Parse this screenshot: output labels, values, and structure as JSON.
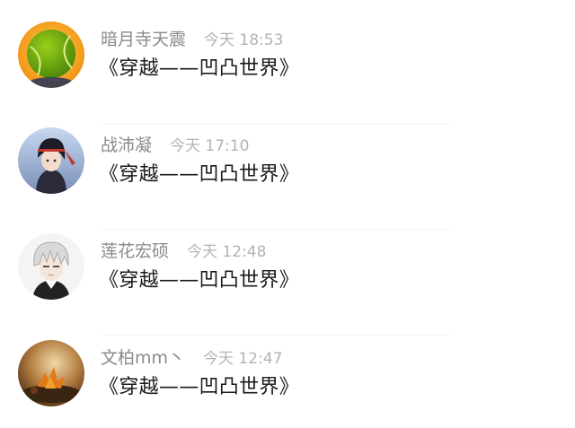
{
  "comments": [
    {
      "name": "暗月寺天震",
      "time": "今天 18:53",
      "title": "《穿越——凹凸世界》",
      "avatar_icon": "tennis-ball-avatar-icon"
    },
    {
      "name": "战沛凝",
      "time": "今天 17:10",
      "title": "《穿越——凹凸世界》",
      "avatar_icon": "anime-character-avatar-icon"
    },
    {
      "name": "莲花宏硕",
      "time": "今天 12:48",
      "title": "《穿越——凹凸世界》",
      "avatar_icon": "anime-silver-hair-avatar-icon"
    },
    {
      "name": "文柏mm丶",
      "time": "今天 12:47",
      "title": "《穿越——凹凸世界》",
      "avatar_icon": "autumn-leaf-avatar-icon"
    }
  ],
  "colors": {
    "name": "#8a8a8a",
    "time": "#b3b3b3",
    "title": "#1a1a1a",
    "background": "#ffffff"
  }
}
